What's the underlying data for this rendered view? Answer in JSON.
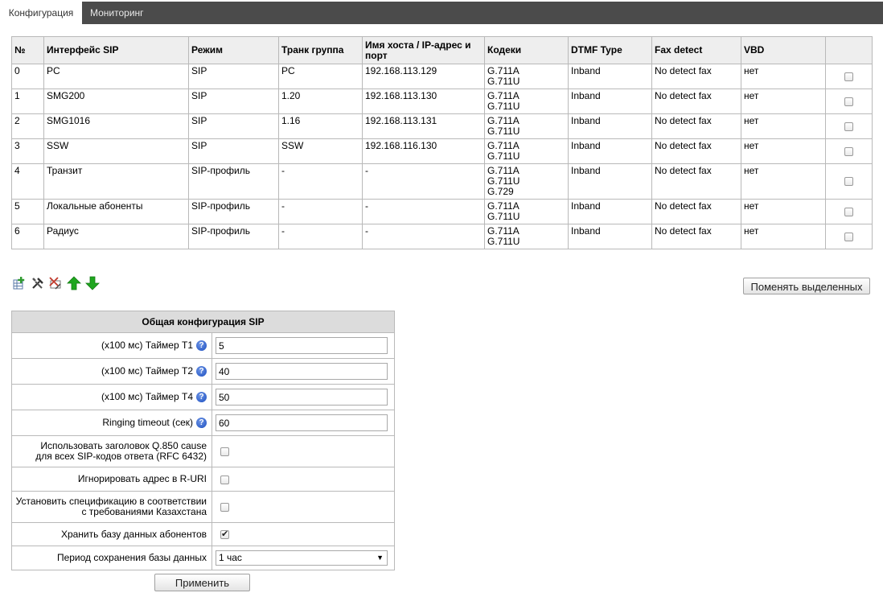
{
  "tabs": [
    {
      "label": "Конфигурация",
      "active": true
    },
    {
      "label": "Мониторинг",
      "active": false
    }
  ],
  "interfaces": {
    "columns": [
      "№",
      "Интерфейс SIP",
      "Режим",
      "Транк группа",
      "Имя хоста / IP-адрес и порт",
      "Кодеки",
      "DTMF Type",
      "Fax detect",
      "VBD"
    ],
    "rows": [
      {
        "num": "0",
        "name": "PC",
        "mode": "SIP",
        "trunk": "PC",
        "host": "192.168.113.129",
        "codecs": [
          "G.711A",
          "G.711U"
        ],
        "dtmf": "Inband",
        "fax": "No detect fax",
        "vbd": "нет"
      },
      {
        "num": "1",
        "name": "SMG200",
        "mode": "SIP",
        "trunk": "1.20",
        "host": "192.168.113.130",
        "codecs": [
          "G.711A",
          "G.711U"
        ],
        "dtmf": "Inband",
        "fax": "No detect fax",
        "vbd": "нет"
      },
      {
        "num": "2",
        "name": "SMG1016",
        "mode": "SIP",
        "trunk": "1.16",
        "host": "192.168.113.131",
        "codecs": [
          "G.711A",
          "G.711U"
        ],
        "dtmf": "Inband",
        "fax": "No detect fax",
        "vbd": "нет"
      },
      {
        "num": "3",
        "name": "SSW",
        "mode": "SIP",
        "trunk": "SSW",
        "host": "192.168.116.130",
        "codecs": [
          "G.711A",
          "G.711U"
        ],
        "dtmf": "Inband",
        "fax": "No detect fax",
        "vbd": "нет"
      },
      {
        "num": "4",
        "name": "Транзит",
        "mode": "SIP-профиль",
        "trunk": "-",
        "host": "-",
        "codecs": [
          "G.711A",
          "G.711U",
          "G.729"
        ],
        "dtmf": "Inband",
        "fax": "No detect fax",
        "vbd": "нет"
      },
      {
        "num": "5",
        "name": "Локальные абоненты",
        "mode": "SIP-профиль",
        "trunk": "-",
        "host": "-",
        "codecs": [
          "G.711A",
          "G.711U"
        ],
        "dtmf": "Inband",
        "fax": "No detect fax",
        "vbd": "нет"
      },
      {
        "num": "6",
        "name": "Радиус",
        "mode": "SIP-профиль",
        "trunk": "-",
        "host": "-",
        "codecs": [
          "G.711A",
          "G.711U"
        ],
        "dtmf": "Inband",
        "fax": "No detect fax",
        "vbd": "нет"
      }
    ]
  },
  "toolbar": {
    "icons": [
      "add-icon",
      "edit-icon",
      "delete-icon",
      "move-up-icon",
      "move-down-icon"
    ],
    "change_selected_label": "Поменять выделенных"
  },
  "sip_config": {
    "title": "Общая конфигурация SIP",
    "t1": {
      "label": "(x100 мс) Таймер T1",
      "value": "5"
    },
    "t2": {
      "label": "(x100 мс) Таймер T2",
      "value": "40"
    },
    "t4": {
      "label": "(x100 мс) Таймер T4",
      "value": "50"
    },
    "ringing": {
      "label": "Ringing timeout (сек)",
      "value": "60"
    },
    "q850": {
      "label_line1": "Использовать заголовок Q.850 cause",
      "label_line2": "для всех SIP-кодов ответа (RFC 6432)",
      "checked": false
    },
    "ignore_ruri": {
      "label": "Игнорировать адрес в R-URI",
      "checked": false
    },
    "kazakhstan": {
      "label_line1": "Установить спецификацию в соответствии",
      "label_line2": "с требованиями Казахстана",
      "checked": false
    },
    "store_db": {
      "label": "Хранить базу данных абонентов",
      "checked": true
    },
    "save_period": {
      "label": "Период сохранения базы данных",
      "value": "1 час"
    }
  },
  "apply_label": "Применить",
  "colors": {
    "tabbar": "#4b4b4b",
    "header_bg": "#eeeeee",
    "cfg_header_bg": "#dcdcdc",
    "border": "#b9b9b9",
    "arrow_green": "#1fa61f"
  }
}
